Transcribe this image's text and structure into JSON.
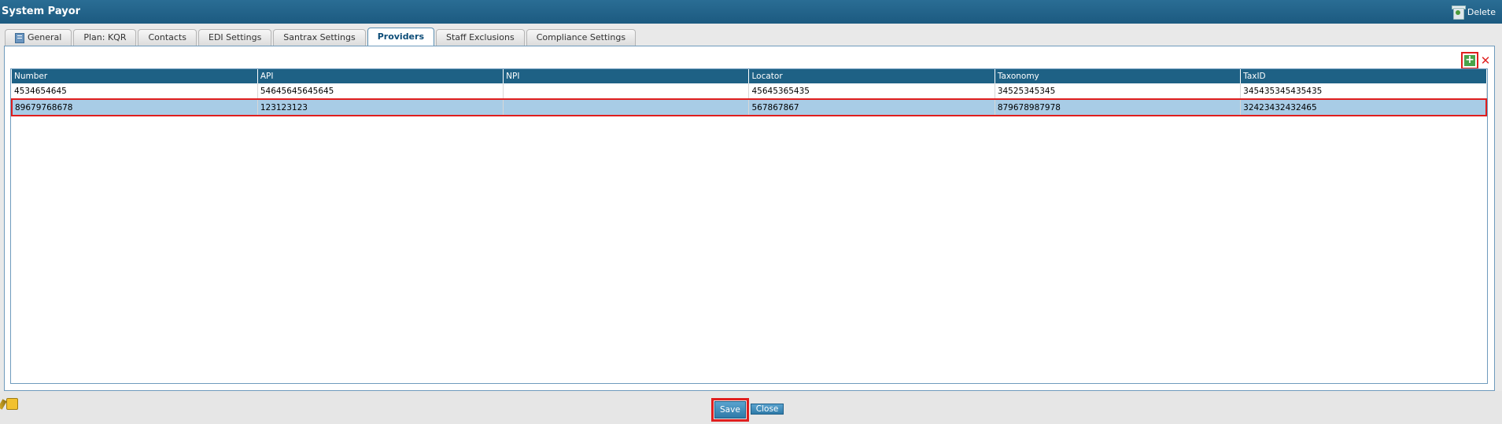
{
  "window": {
    "title": "System Payor",
    "delete_label": "Delete"
  },
  "tabs": [
    {
      "label": "General",
      "active": false
    },
    {
      "label": "Plan: KQR",
      "active": false
    },
    {
      "label": "Contacts",
      "active": false
    },
    {
      "label": "EDI Settings",
      "active": false
    },
    {
      "label": "Santrax Settings",
      "active": false
    },
    {
      "label": "Providers",
      "active": true
    },
    {
      "label": "Staff Exclusions",
      "active": false
    },
    {
      "label": "Compliance Settings",
      "active": false
    }
  ],
  "grid": {
    "columns": [
      "Number",
      "API",
      "NPI",
      "Locator",
      "Taxonomy",
      "TaxID"
    ],
    "rows": [
      [
        "4534654645",
        "54645645645645",
        "",
        "45645365435",
        "34525345345",
        "345435345435435"
      ],
      [
        "89679768678",
        "123123123",
        "",
        "567867867",
        "879678987978",
        "32423432432465"
      ]
    ],
    "selected_row": 1,
    "add_icon": "plus-icon",
    "remove_icon": "close-icon"
  },
  "footer": {
    "save_label": "Save",
    "close_label": "Close"
  },
  "colors": {
    "header": "#1e6185",
    "selected_row": "#a8cce6",
    "highlight": "#e01e1e",
    "accent": "#49a34a"
  }
}
